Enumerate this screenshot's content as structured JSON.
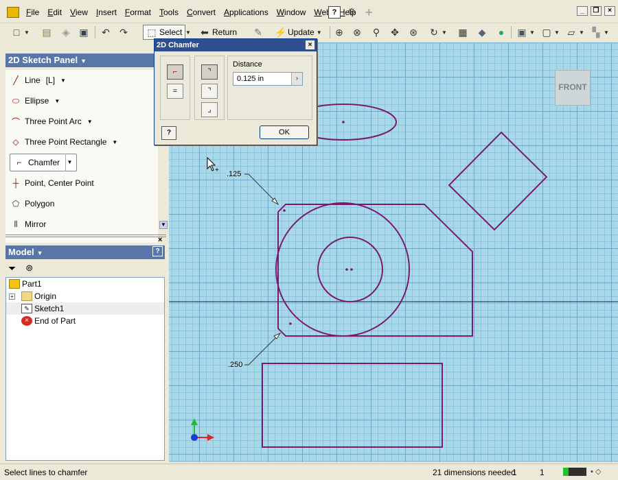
{
  "menu": {
    "items": [
      "File",
      "Edit",
      "View",
      "Insert",
      "Format",
      "Tools",
      "Convert",
      "Applications",
      "Window",
      "Web",
      "Help"
    ]
  },
  "toolbar": {
    "select_label": "Select",
    "return_label": "Return",
    "update_label": "Update"
  },
  "sketch_panel": {
    "title": "2D Sketch Panel",
    "tools": [
      {
        "label": "Line",
        "shortcut": "[L]"
      },
      {
        "label": "Ellipse"
      },
      {
        "label": "Three Point Arc"
      },
      {
        "label": "Three Point Rectangle"
      },
      {
        "label": "Chamfer"
      },
      {
        "label": "Point, Center Point"
      },
      {
        "label": "Polygon"
      },
      {
        "label": "Mirror"
      }
    ]
  },
  "model_panel": {
    "title": "Model",
    "tree": [
      "Part1",
      "Origin",
      "Sketch1",
      "End of Part"
    ]
  },
  "dialog": {
    "title": "2D Chamfer",
    "distance_label": "Distance",
    "distance_value": "0.125 in",
    "ok_label": "OK"
  },
  "canvas": {
    "viewcube_label": "FRONT",
    "dim_top": ".125",
    "dim_bottom": ".250"
  },
  "status": {
    "message": "Select lines to chamfer",
    "dimensions": "21 dimensions needed",
    "value1": "1",
    "value2": "1"
  }
}
